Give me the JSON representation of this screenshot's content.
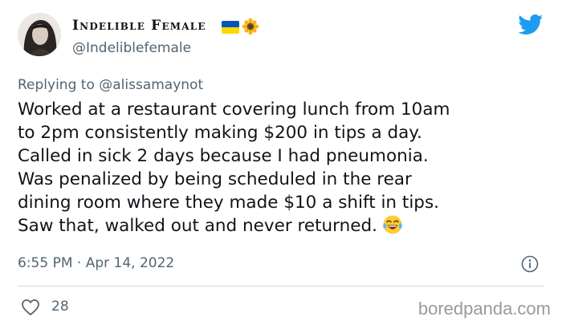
{
  "author": {
    "display_name": "Indelible Female",
    "handle": "@Indeliblefemale"
  },
  "reply": {
    "prefix": "Replying to",
    "to_handle": "@alissamaynot"
  },
  "tweet": {
    "lines": [
      "Worked at a restaurant covering lunch from 10am",
      "to 2pm consistently making $200 in tips a day.",
      "Called in sick 2 days because I had pneumonia.",
      "Was penalized by being scheduled in the rear",
      "dining room where they made $10 a shift in tips.",
      "Saw that, walked out and never returned."
    ],
    "emoji": "face-with-tears-of-joy-icon"
  },
  "meta": {
    "timestamp": "6:55 PM · Apr 14, 2022"
  },
  "stats": {
    "likes": "28"
  },
  "watermark": "boredpanda.com",
  "icons": {
    "brand": "twitter-bird-icon",
    "flag": "ukraine-flag-icon",
    "flower": "sunflower-icon",
    "info": "info-icon",
    "like": "heart-icon"
  },
  "colors": {
    "twitter_blue": "#1d9bf0",
    "secondary_text": "#536471",
    "primary_text": "#0f1419",
    "flag_blue": "#0057b7",
    "flag_yellow": "#ffd700"
  }
}
